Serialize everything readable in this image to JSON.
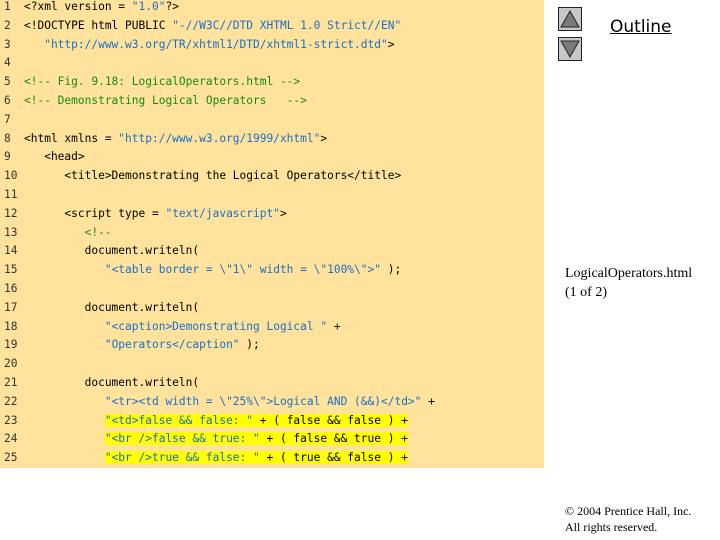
{
  "outline_label": "Outline",
  "file_label": "LogicalOperators.html",
  "page_label": "(1 of 2)",
  "copyright": "© 2004 Prentice Hall, Inc.",
  "rights": "All rights reserved.",
  "code_lines": [
    {
      "n": "1",
      "segs": [
        {
          "t": "<?xml version = ",
          "k": "k"
        },
        {
          "t": "\"1.0\"",
          "k": "s"
        },
        {
          "t": "?>",
          "k": "k"
        }
      ]
    },
    {
      "n": "2",
      "segs": [
        {
          "t": "<!DOCTYPE html PUBLIC ",
          "k": "k"
        },
        {
          "t": "\"-//W3C//DTD XHTML 1.0 Strict//EN\"",
          "k": "s"
        }
      ]
    },
    {
      "n": "3",
      "segs": [
        {
          "t": "   \"http://www.w3.org/TR/xhtml1/DTD/xhtml1-strict.dtd\"",
          "k": "s"
        },
        {
          "t": ">",
          "k": "k"
        }
      ]
    },
    {
      "n": "4",
      "segs": []
    },
    {
      "n": "5",
      "segs": [
        {
          "t": "<!-- Fig. 9.18: LogicalOperators.html -->",
          "k": "c"
        }
      ]
    },
    {
      "n": "6",
      "segs": [
        {
          "t": "<!-- Demonstrating Logical Operators   -->",
          "k": "c"
        }
      ]
    },
    {
      "n": "7",
      "segs": []
    },
    {
      "n": "8",
      "segs": [
        {
          "t": "<html xmlns = ",
          "k": "k"
        },
        {
          "t": "\"http://www.w3.org/1999/xhtml\"",
          "k": "s"
        },
        {
          "t": ">",
          "k": "k"
        }
      ]
    },
    {
      "n": "9",
      "segs": [
        {
          "t": "   <head>",
          "k": "k"
        }
      ]
    },
    {
      "n": "10",
      "segs": [
        {
          "t": "      <title>Demonstrating the Logical Operators</title>",
          "k": "k"
        }
      ]
    },
    {
      "n": "11",
      "segs": []
    },
    {
      "n": "12",
      "segs": [
        {
          "t": "      <script type = ",
          "k": "k"
        },
        {
          "t": "\"text/javascript\"",
          "k": "s"
        },
        {
          "t": ">",
          "k": "k"
        }
      ]
    },
    {
      "n": "13",
      "segs": [
        {
          "t": "         <!--",
          "k": "c"
        }
      ]
    },
    {
      "n": "14",
      "segs": [
        {
          "t": "         document.writeln(",
          "k": "k"
        }
      ]
    },
    {
      "n": "15",
      "segs": [
        {
          "t": "            ",
          "k": "k"
        },
        {
          "t": "\"<table border = \\\"1\\\" width = \\\"100%\\\">\"",
          "k": "s"
        },
        {
          "t": " );",
          "k": "k"
        }
      ]
    },
    {
      "n": "16",
      "segs": []
    },
    {
      "n": "17",
      "segs": [
        {
          "t": "         document.writeln(",
          "k": "k"
        }
      ]
    },
    {
      "n": "18",
      "segs": [
        {
          "t": "            ",
          "k": "k"
        },
        {
          "t": "\"<caption>Demonstrating Logical \"",
          "k": "s"
        },
        {
          "t": " +",
          "k": "k"
        }
      ]
    },
    {
      "n": "19",
      "segs": [
        {
          "t": "            ",
          "k": "k"
        },
        {
          "t": "\"Operators</caption\"",
          "k": "s"
        },
        {
          "t": " );",
          "k": "k"
        }
      ]
    },
    {
      "n": "20",
      "segs": []
    },
    {
      "n": "21",
      "segs": [
        {
          "t": "         document.writeln(",
          "k": "k"
        }
      ]
    },
    {
      "n": "22",
      "segs": [
        {
          "t": "            ",
          "k": "k"
        },
        {
          "t": "\"<tr><td width = \\\"25%\\\">Logical AND (&&)</td>\"",
          "k": "s"
        },
        {
          "t": " +",
          "k": "k"
        }
      ]
    },
    {
      "n": "23",
      "segs": [
        {
          "t": "            ",
          "k": "k"
        },
        {
          "t": "\"<td>false && false: \"",
          "k": "s hl"
        },
        {
          "t": " + ( false && false ) +",
          "k": "k hl"
        }
      ]
    },
    {
      "n": "24",
      "segs": [
        {
          "t": "            ",
          "k": "k"
        },
        {
          "t": "\"<br />false && true: \"",
          "k": "s hl"
        },
        {
          "t": " + ( false && true ) +",
          "k": "k hl"
        }
      ]
    },
    {
      "n": "25",
      "segs": [
        {
          "t": "            ",
          "k": "k"
        },
        {
          "t": "\"<br />true && false: \"",
          "k": "s hl"
        },
        {
          "t": " + ( true && false ) +",
          "k": "k hl"
        }
      ]
    }
  ]
}
